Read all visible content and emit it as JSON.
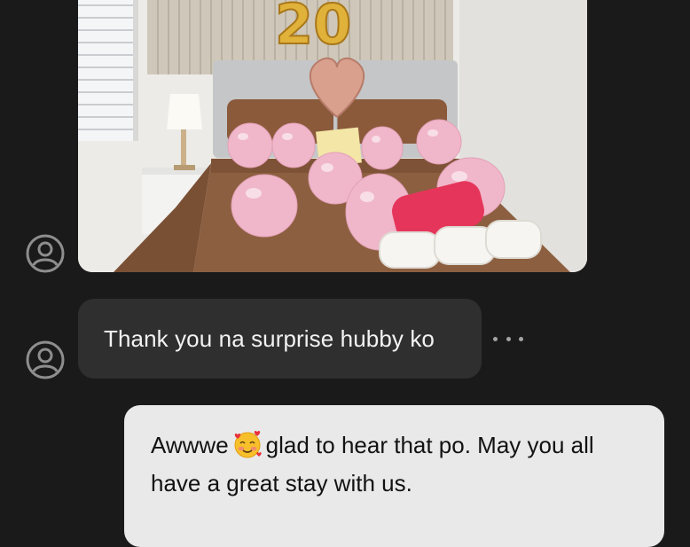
{
  "conversation": {
    "messages": [
      {
        "from": "contact",
        "type": "image",
        "image_description": "Bedroom with pink balloons, gold 20 balloons and rose-gold heart balloon, towels on bed"
      },
      {
        "from": "contact",
        "type": "text",
        "text": "Thank you na surprise hubby ko"
      },
      {
        "from": "me",
        "type": "text",
        "text_before_emoji": "Awwwe",
        "emoji": "smiling-face-with-hearts",
        "text_after_emoji": "glad to hear that po. May you all",
        "text_line2": "have a great stay with us."
      }
    ]
  },
  "photo": {
    "balloon_number_text": "20"
  },
  "colors": {
    "background": "#1a1a1a",
    "incoming_bubble": "#2f2f2f",
    "outgoing_bubble": "#e9e9e9",
    "avatar_outline": "#8e8e8e"
  },
  "icons": {
    "avatar": "user-circle-icon",
    "more": "more-horizontal-icon",
    "emoji": "smiling-face-with-hearts-emoji"
  }
}
